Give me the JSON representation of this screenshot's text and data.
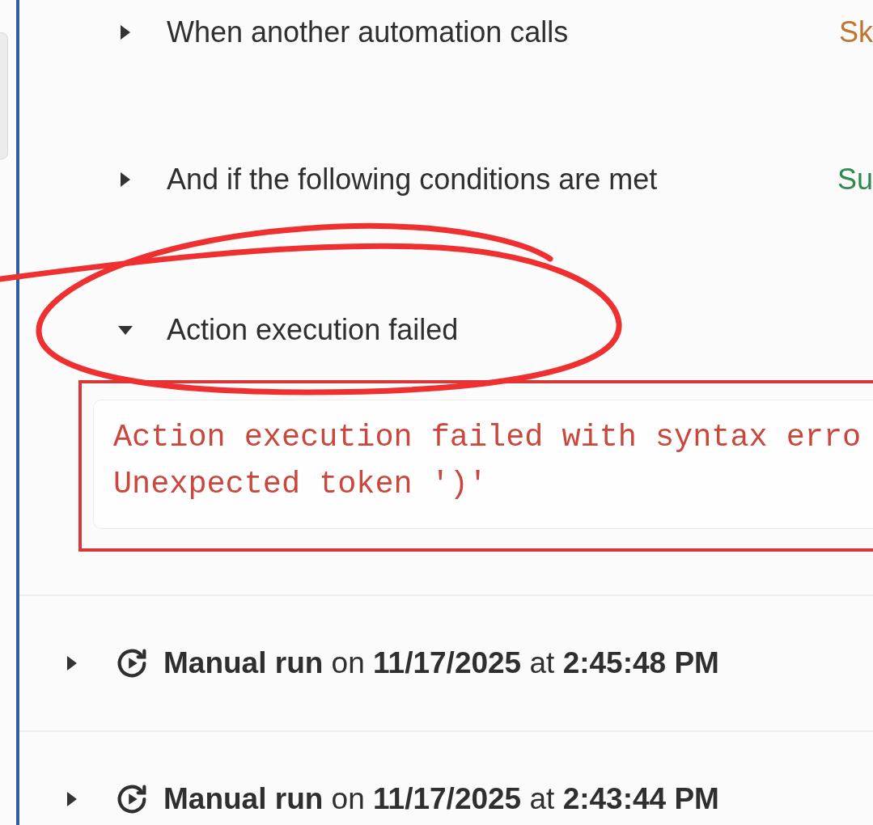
{
  "steps": [
    {
      "label": "When another automation calls",
      "expanded": false,
      "status": "Sk",
      "color": "#c0742e"
    },
    {
      "label": "And if the following conditions are met",
      "expanded": false,
      "status": "Su",
      "color": "#2e8a4e"
    },
    {
      "label": "Action execution failed",
      "expanded": true,
      "error_lines": [
        "Action execution failed with syntax erro",
        "Unexpected token ')'"
      ]
    }
  ],
  "runs": [
    {
      "text": "**Manual run** on **11/17/2025** at **2:45:48 PM**",
      "expanded": false
    },
    {
      "text": "**Manual run** on **11/17/2025** at **2:43:44 PM**",
      "expanded": false
    }
  ]
}
